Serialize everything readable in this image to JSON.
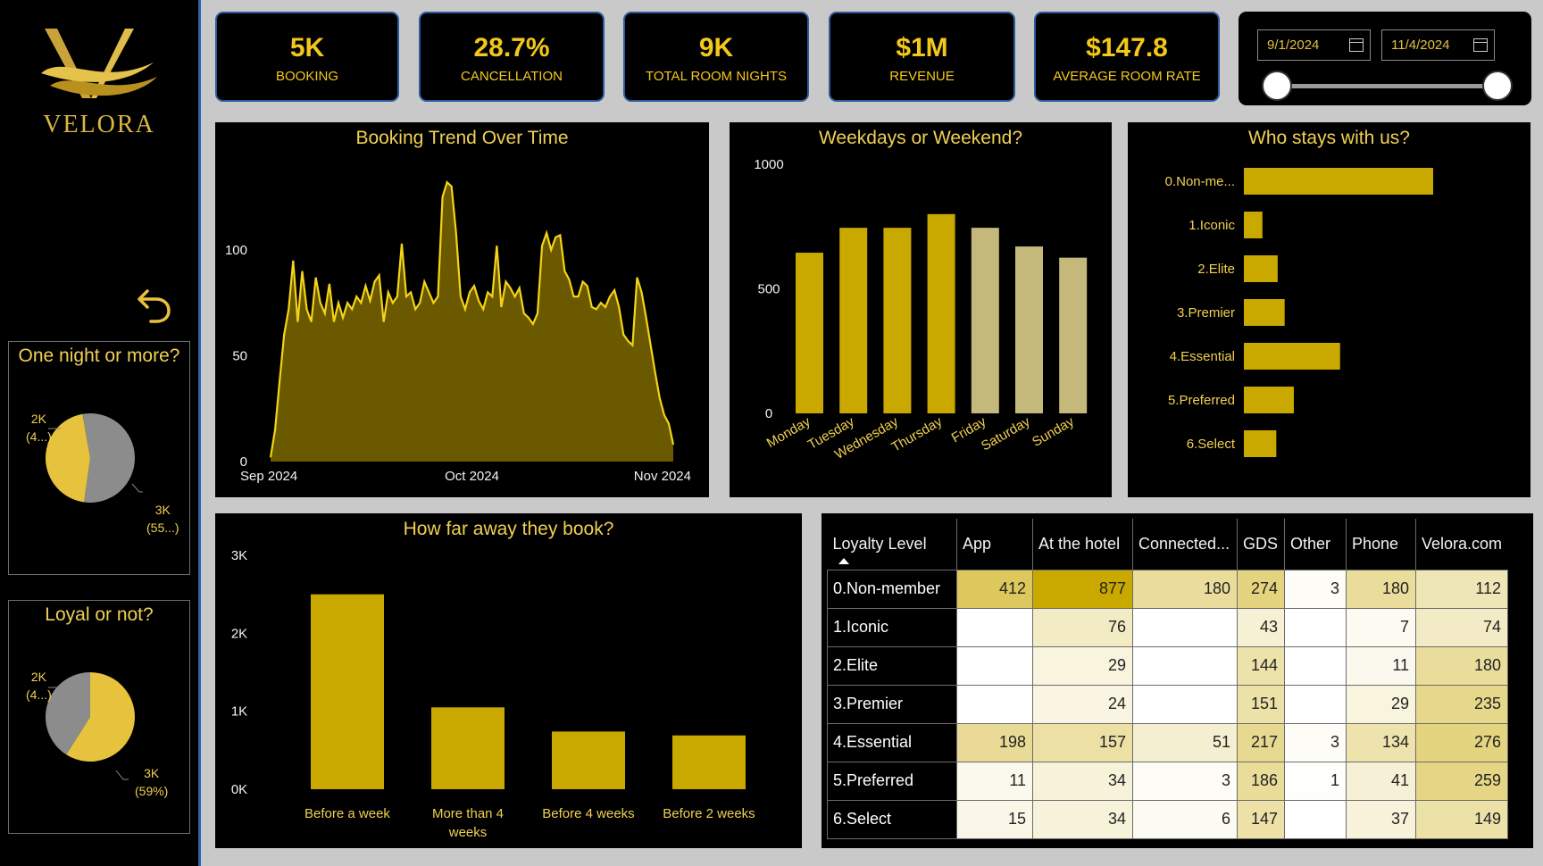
{
  "brand": {
    "name": "VELORA",
    "logo_letter": "V"
  },
  "sidebar": {
    "back_icon": "undo-arrow-icon",
    "pie_one_night": {
      "title": "One night or more?",
      "label_a_top": "2K",
      "label_a_bottom": "(4...)",
      "label_b_top": "3K",
      "label_b_bottom": "(55...)",
      "share_gold": 0.45,
      "share_grey": 0.55
    },
    "pie_loyal": {
      "title": "Loyal or not?",
      "label_a_top": "2K",
      "label_a_bottom": "(4...)",
      "label_b_top": "3K",
      "label_b_bottom": "(59%)",
      "share_gold": 0.59,
      "share_grey": 0.41
    }
  },
  "kpis": [
    {
      "value": "5K",
      "label": "BOOKING"
    },
    {
      "value": "28.7%",
      "label": "CANCELLATION"
    },
    {
      "value": "9K",
      "label": "TOTAL ROOM NIGHTS"
    },
    {
      "value": "$1M",
      "label": "REVENUE"
    },
    {
      "value": "$147.8",
      "label": "AVERAGE ROOM RATE"
    }
  ],
  "date_filter": {
    "start": "9/1/2024",
    "end": "11/4/2024",
    "icon": "calendar-icon"
  },
  "colors": {
    "gold": "#c9a800",
    "pale_gold": "#c4b87a",
    "grey": "#8c8c8c",
    "light_gold": "#e7c23c"
  },
  "chart_data": [
    {
      "id": "trend",
      "type": "area",
      "title": "Booking Trend Over Time",
      "x_tick_labels": [
        "Sep 2024",
        "Oct 2024",
        "Nov 2024"
      ],
      "y_ticks": [
        0,
        50,
        100
      ],
      "ylim": [
        0,
        135
      ],
      "values": [
        2,
        15,
        38,
        60,
        72,
        95,
        66,
        90,
        72,
        66,
        87,
        75,
        70,
        84,
        66,
        75,
        68,
        75,
        72,
        78,
        75,
        83,
        76,
        85,
        88,
        66,
        80,
        75,
        78,
        103,
        78,
        80,
        72,
        75,
        85,
        80,
        75,
        78,
        125,
        132,
        130,
        108,
        78,
        72,
        80,
        83,
        76,
        72,
        80,
        78,
        102,
        73,
        85,
        82,
        78,
        82,
        70,
        68,
        65,
        70,
        102,
        108,
        100,
        106,
        107,
        90,
        86,
        78,
        78,
        85,
        83,
        73,
        72,
        75,
        73,
        78,
        81,
        73,
        60,
        57,
        55,
        87,
        80,
        68,
        55,
        42,
        30,
        22,
        18,
        8
      ]
    },
    {
      "id": "weekday",
      "type": "bar",
      "title": "Weekdays or Weekend?",
      "categories": [
        "Monday",
        "Tuesday",
        "Wednesday",
        "Thursday",
        "Friday",
        "Saturday",
        "Sunday"
      ],
      "values": [
        645,
        745,
        745,
        800,
        745,
        670,
        625
      ],
      "weekend_flags": [
        false,
        false,
        false,
        false,
        true,
        true,
        true
      ],
      "y_ticks": [
        0,
        500,
        1000
      ],
      "ylim": [
        0,
        1000
      ]
    },
    {
      "id": "loyalty",
      "type": "bar",
      "title": "Who stays with us?",
      "categories": [
        "0.Non-me...",
        "1.Iconic",
        "2.Elite",
        "3.Premier",
        "4.Essential",
        "5.Preferred",
        "6.Select"
      ],
      "values": [
        2038,
        200,
        364,
        439,
        1036,
        538,
        349
      ],
      "orientation": "horizontal"
    },
    {
      "id": "leadtime",
      "type": "bar",
      "title": "How far away they book?",
      "categories": [
        "Before a week",
        "More than 4 weeks",
        "Before 4 weeks",
        "Before 2 weeks"
      ],
      "values": [
        2500,
        1050,
        740,
        690
      ],
      "y_tick_labels": [
        "0K",
        "1K",
        "2K",
        "3K"
      ],
      "ylim": [
        0,
        3000
      ]
    }
  ],
  "matrix": {
    "header_first": "Loyalty Level",
    "sort_icon": "sort-up-icon",
    "columns": [
      "App",
      "At the hotel",
      "Connected...",
      "GDS",
      "Other",
      "Phone",
      "Velora.com"
    ],
    "rows": [
      {
        "label": "0.Non-member",
        "cells": [
          "412",
          "877",
          "180",
          "274",
          "3",
          "180",
          "112"
        ]
      },
      {
        "label": "1.Iconic",
        "cells": [
          "",
          "76",
          "",
          "43",
          "",
          "7",
          "74"
        ]
      },
      {
        "label": "2.Elite",
        "cells": [
          "",
          "29",
          "",
          "144",
          "",
          "11",
          "180"
        ]
      },
      {
        "label": "3.Premier",
        "cells": [
          "",
          "24",
          "",
          "151",
          "",
          "29",
          "235"
        ]
      },
      {
        "label": "4.Essential",
        "cells": [
          "198",
          "157",
          "51",
          "217",
          "3",
          "134",
          "276"
        ]
      },
      {
        "label": "5.Preferred",
        "cells": [
          "11",
          "34",
          "3",
          "186",
          "1",
          "41",
          "259"
        ]
      },
      {
        "label": "6.Select",
        "cells": [
          "15",
          "34",
          "6",
          "147",
          "",
          "37",
          "149"
        ]
      }
    ]
  }
}
